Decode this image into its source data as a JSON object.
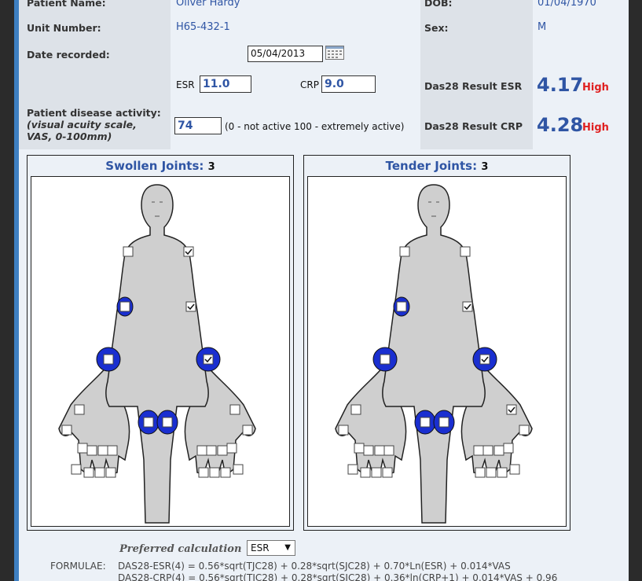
{
  "patient": {
    "name_label": "Patient Name:",
    "name_value": "Oliver Hardy",
    "unit_label": "Unit Number:",
    "unit_value": "H65-432-1",
    "dob_label": "DOB:",
    "dob_value": "01/04/1970",
    "sex_label": "Sex:",
    "sex_value": "M",
    "date_label": "Date recorded:",
    "date_value": "05/04/2013"
  },
  "labs": {
    "esr_label": "ESR",
    "esr_value": "11.0",
    "crp_label": "CRP",
    "crp_value": "9.0"
  },
  "activity": {
    "label_line1": "Patient disease activity:",
    "label_line2": "(visual acuity scale,",
    "label_line3": "VAS, 0-100mm)",
    "value": "74",
    "hint": "(0 - not active 100 - extremely active)"
  },
  "results": {
    "esr_label": "Das28 Result ESR",
    "esr_value": "4.17",
    "esr_level": "High",
    "crp_label": "Das28 Result CRP",
    "crp_value": "4.28",
    "crp_level": "High"
  },
  "swollen": {
    "title": "Swollen Joints:",
    "count": "3"
  },
  "tender": {
    "title": "Tender Joints:",
    "count": "3"
  },
  "footer": {
    "pref_label": "Preferred calculation",
    "pref_value": "ESR",
    "formulae_label": "FORMULAE:",
    "formula_esr": "DAS28-ESR(4) = 0.56*sqrt(TJC28) + 0.28*sqrt(SJC28) + 0.70*Ln(ESR) + 0.014*VAS",
    "formula_crp": "DAS28-CRP(4) = 0.56*sqrt(TJC28) + 0.28*sqrt(SJC28) + 0.36*ln(CRP+1) + 0.014*VAS + 0.96"
  },
  "colors": {
    "accent": "#2f55a4",
    "alert": "#e02020",
    "joint_blue": "#1a2fd0"
  },
  "icons": {
    "calendar": "calendar-icon",
    "dropdown": "chevron-down-icon"
  }
}
